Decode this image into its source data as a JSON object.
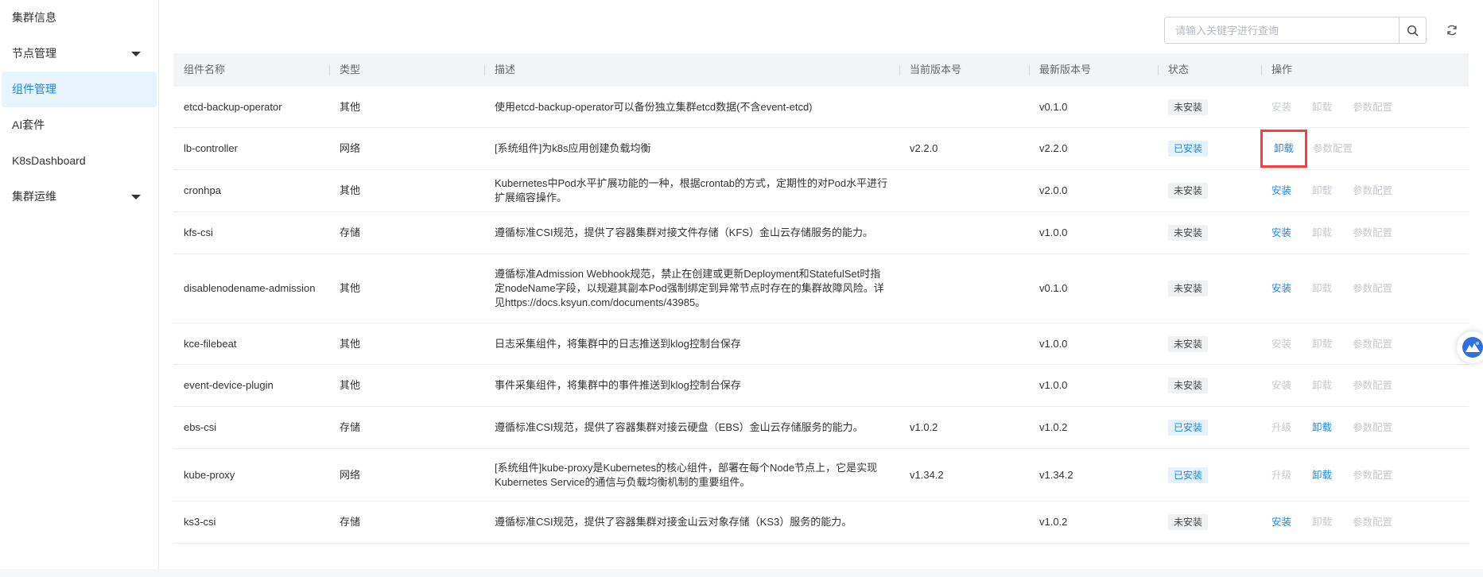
{
  "sidebar": {
    "items": [
      {
        "label": "集群信息",
        "expandable": false,
        "active": false
      },
      {
        "label": "节点管理",
        "expandable": true,
        "active": false
      },
      {
        "label": "组件管理",
        "expandable": false,
        "active": true
      },
      {
        "label": "AI套件",
        "expandable": false,
        "active": false
      },
      {
        "label": "K8sDashboard",
        "expandable": false,
        "active": false
      },
      {
        "label": "集群运维",
        "expandable": true,
        "active": false
      }
    ]
  },
  "toolbar": {
    "search_placeholder": "请输入关键字进行查询",
    "search_icon": "search-icon",
    "refresh_icon": "refresh-icon"
  },
  "table": {
    "headers": [
      "组件名称",
      "类型",
      "描述",
      "当前版本号",
      "最新版本号",
      "状态",
      "操作"
    ],
    "rows": [
      {
        "name": "etcd-backup-operator",
        "type": "其他",
        "desc": "使用etcd-backup-operator可以备份独立集群etcd数据(不含event-etcd)",
        "current": "",
        "latest": "v0.1.0",
        "status": "未安装",
        "installed": false,
        "actions": [
          {
            "label": "安装",
            "enabled": false
          },
          {
            "label": "卸载",
            "enabled": false
          },
          {
            "label": "参数配置",
            "enabled": false
          }
        ]
      },
      {
        "name": "lb-controller",
        "type": "网络",
        "desc": "[系统组件]为k8s应用创建负载均衡",
        "current": "v2.2.0",
        "latest": "v2.2.0",
        "status": "已安装",
        "installed": true,
        "actions": [
          {
            "label": "卸载",
            "enabled": true,
            "highlight": true
          },
          {
            "label": "参数配置",
            "enabled": false
          }
        ]
      },
      {
        "name": "cronhpa",
        "type": "其他",
        "desc": "Kubernetes中Pod水平扩展功能的一种，根据crontab的方式，定期性的对Pod水平进行扩展缩容操作。",
        "current": "",
        "latest": "v2.0.0",
        "status": "未安装",
        "installed": false,
        "actions": [
          {
            "label": "安装",
            "enabled": true
          },
          {
            "label": "卸载",
            "enabled": false
          },
          {
            "label": "参数配置",
            "enabled": false
          }
        ]
      },
      {
        "name": "kfs-csi",
        "type": "存储",
        "desc": "遵循标准CSI规范，提供了容器集群对接文件存储（KFS）金山云存储服务的能力。",
        "current": "",
        "latest": "v1.0.0",
        "status": "未安装",
        "installed": false,
        "actions": [
          {
            "label": "安装",
            "enabled": true
          },
          {
            "label": "卸载",
            "enabled": false
          },
          {
            "label": "参数配置",
            "enabled": false
          }
        ]
      },
      {
        "name": "disablenodename-admission",
        "type": "其他",
        "desc": "遵循标准Admission Webhook规范，禁止在创建或更新Deployment和StatefulSet时指定nodeName字段，以规避其副本Pod强制绑定到异常节点时存在的集群故障风险。详见https://docs.ksyun.com/documents/43985。",
        "current": "",
        "latest": "v0.1.0",
        "status": "未安装",
        "installed": false,
        "actions": [
          {
            "label": "安装",
            "enabled": true
          },
          {
            "label": "卸载",
            "enabled": false
          },
          {
            "label": "参数配置",
            "enabled": false
          }
        ]
      },
      {
        "name": "kce-filebeat",
        "type": "其他",
        "desc": "日志采集组件，将集群中的日志推送到klog控制台保存",
        "current": "",
        "latest": "v1.0.0",
        "status": "未安装",
        "installed": false,
        "actions": [
          {
            "label": "安装",
            "enabled": false
          },
          {
            "label": "卸载",
            "enabled": false
          },
          {
            "label": "参数配置",
            "enabled": false
          }
        ]
      },
      {
        "name": "event-device-plugin",
        "type": "其他",
        "desc": "事件采集组件，将集群中的事件推送到klog控制台保存",
        "current": "",
        "latest": "v1.0.0",
        "status": "未安装",
        "installed": false,
        "actions": [
          {
            "label": "安装",
            "enabled": false
          },
          {
            "label": "卸载",
            "enabled": false
          },
          {
            "label": "参数配置",
            "enabled": false
          }
        ]
      },
      {
        "name": "ebs-csi",
        "type": "存储",
        "desc": "遵循标准CSI规范，提供了容器集群对接云硬盘（EBS）金山云存储服务的能力。",
        "current": "v1.0.2",
        "latest": "v1.0.2",
        "status": "已安装",
        "installed": true,
        "actions": [
          {
            "label": "升级",
            "enabled": false
          },
          {
            "label": "卸载",
            "enabled": true
          },
          {
            "label": "参数配置",
            "enabled": false
          }
        ]
      },
      {
        "name": "kube-proxy",
        "type": "网络",
        "desc": "[系统组件]kube-proxy是Kubernetes的核心组件，部署在每个Node节点上，它是实现Kubernetes Service的通信与负载均衡机制的重要组件。",
        "current": "v1.34.2",
        "latest": "v1.34.2",
        "status": "已安装",
        "installed": true,
        "actions": [
          {
            "label": "升级",
            "enabled": false
          },
          {
            "label": "卸载",
            "enabled": true
          },
          {
            "label": "参数配置",
            "enabled": false
          }
        ]
      },
      {
        "name": "ks3-csi",
        "type": "存储",
        "desc": "遵循标准CSI规范，提供了容器集群对接金山云对象存储（KS3）服务的能力。",
        "current": "",
        "latest": "v1.0.2",
        "status": "未安装",
        "installed": false,
        "actions": [
          {
            "label": "安装",
            "enabled": true
          },
          {
            "label": "卸载",
            "enabled": false
          },
          {
            "label": "参数配置",
            "enabled": false
          }
        ]
      }
    ]
  },
  "float_help": {
    "icon": "assistant-icon"
  },
  "colors": {
    "accent": "#1e88e5",
    "highlight_box": "#ff3b3b",
    "installed_bg": "#e3f2fd",
    "disabled_text": "#c6c9ce"
  }
}
